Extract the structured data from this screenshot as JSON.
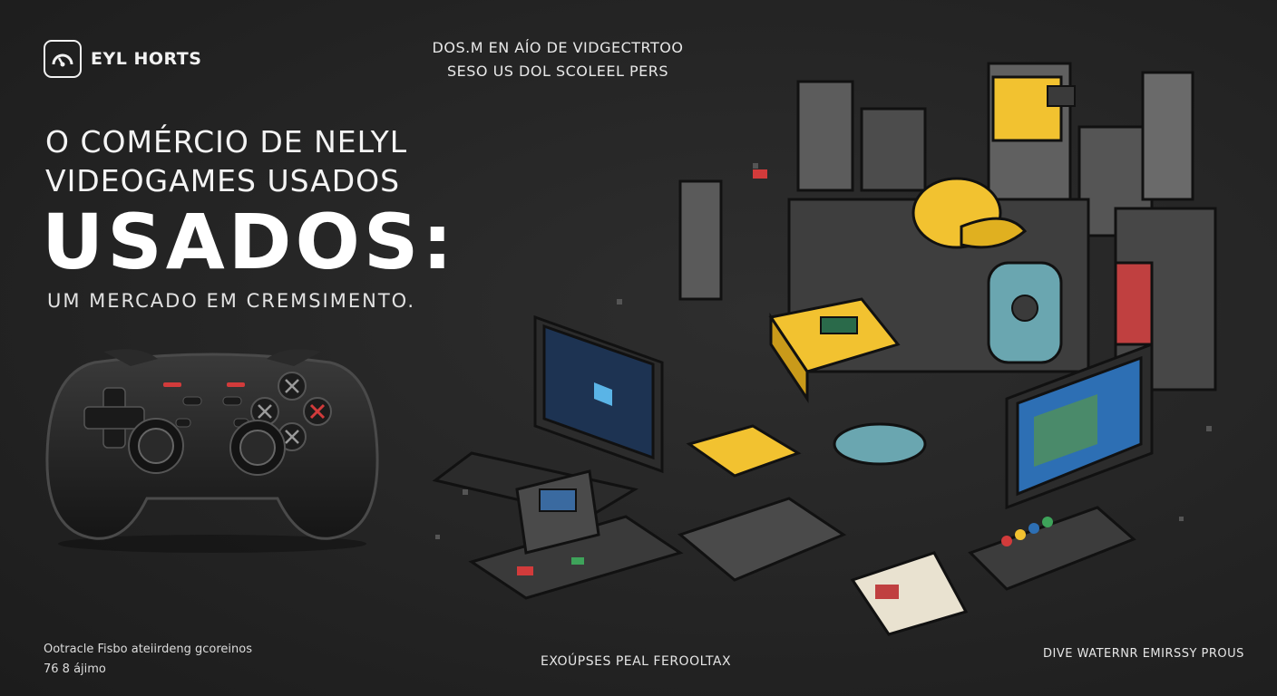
{
  "brand": {
    "name": "EYL HORTS",
    "icon": "gauge-logo-icon"
  },
  "tagline": {
    "line1": "DOS.M EN AÍO DE VIDGECTRTOO",
    "line2": "SESO US DOL SCOLEEL PERS"
  },
  "headline": {
    "line1": "O COMÉRCIO DE NELYL",
    "line2": "VIDEOGAMES USADOS",
    "big": "USADOS:",
    "subtitle": "UM MERCADO EM CREMSIMENTO."
  },
  "footer": {
    "left_line1": "Ootracle Fisbo ateiirdeng gcoreinos",
    "left_line2": "76 8 ájimo",
    "center": "EXOÚPSES PEAL FEROOLTAX",
    "right": "DIVE WATERNR EMIRSSY PROUS"
  },
  "colors": {
    "background": "#262626",
    "accent_yellow": "#f2c230",
    "accent_red": "#d23b3b",
    "accent_teal": "#6aa6b0",
    "screen_blue": "#2d6fb4"
  },
  "illustration": {
    "subject": "isometric pile of retro consoles, monitors, cartridges and controllers",
    "icon": "console-pile-illustration"
  }
}
